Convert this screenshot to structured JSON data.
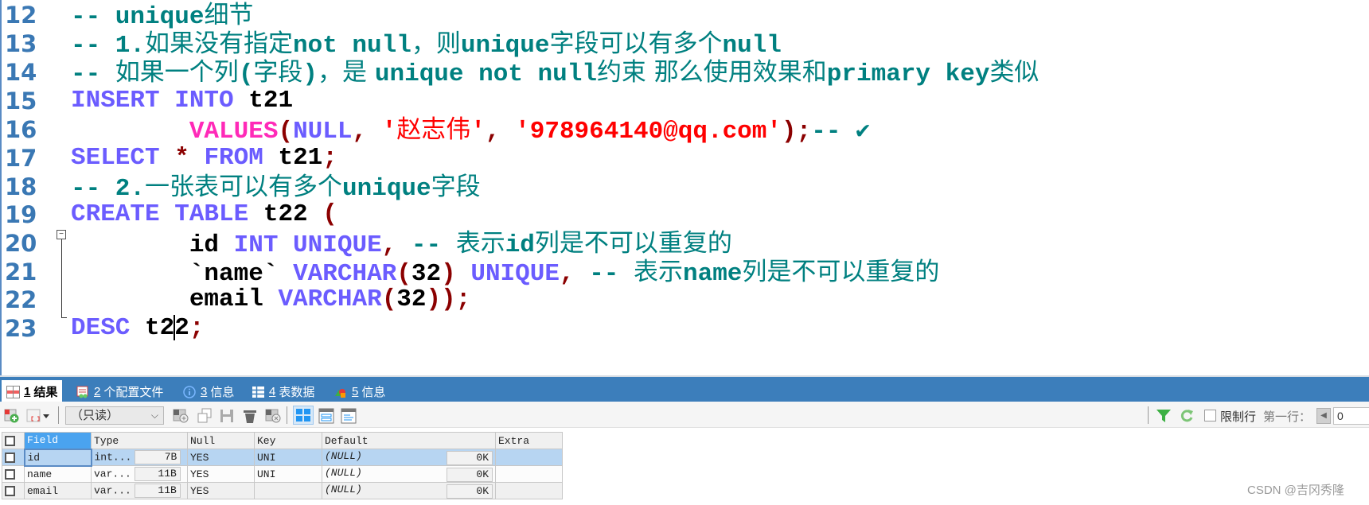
{
  "editor": {
    "lines": [
      {
        "no": "12",
        "segments": [
          {
            "t": "-- unique",
            "c": "cmt"
          },
          {
            "t": "细节",
            "c": "cmt cjk"
          }
        ]
      },
      {
        "no": "13",
        "segments": [
          {
            "t": "-- 1.",
            "c": "cmt"
          },
          {
            "t": "如果没有指定",
            "c": "cmt cjk"
          },
          {
            "t": "not null",
            "c": "cmt"
          },
          {
            "t": "，则",
            "c": "cmt cjk"
          },
          {
            "t": "unique",
            "c": "cmt"
          },
          {
            "t": "字段可以有多个",
            "c": "cmt cjk"
          },
          {
            "t": "null",
            "c": "cmt"
          }
        ]
      },
      {
        "no": "14",
        "segments": [
          {
            "t": "-- ",
            "c": "cmt"
          },
          {
            "t": "如果一个列",
            "c": "cmt cjk"
          },
          {
            "t": "(",
            "c": "cmt"
          },
          {
            "t": "字段",
            "c": "cmt cjk"
          },
          {
            "t": ")",
            "c": "cmt"
          },
          {
            "t": "，是 ",
            "c": "cmt cjk"
          },
          {
            "t": "unique not null",
            "c": "cmt"
          },
          {
            "t": "约束 那么使用效果和",
            "c": "cmt cjk"
          },
          {
            "t": "primary key",
            "c": "cmt"
          },
          {
            "t": "类似",
            "c": "cmt cjk"
          }
        ]
      },
      {
        "no": "15",
        "segments": [
          {
            "t": "INSERT INTO ",
            "c": "kw"
          },
          {
            "t": "t21",
            "c": "id"
          }
        ]
      },
      {
        "no": "16",
        "segments": [
          {
            "t": "        ",
            "c": "id"
          },
          {
            "t": "VALUES",
            "c": "fn"
          },
          {
            "t": "(",
            "c": "punc"
          },
          {
            "t": "NULL",
            "c": "kw"
          },
          {
            "t": ", ",
            "c": "punc"
          },
          {
            "t": "'",
            "c": "str"
          },
          {
            "t": "赵志伟",
            "c": "str cjk"
          },
          {
            "t": "'",
            "c": "str"
          },
          {
            "t": ", ",
            "c": "punc"
          },
          {
            "t": "'978964140@qq.com'",
            "c": "str"
          },
          {
            "t": ");",
            "c": "punc"
          },
          {
            "t": "-- ",
            "c": "cmt"
          },
          {
            "t": "✔",
            "c": "check"
          }
        ]
      },
      {
        "no": "17",
        "segments": [
          {
            "t": "SELECT ",
            "c": "kw"
          },
          {
            "t": "* ",
            "c": "punc"
          },
          {
            "t": "FROM ",
            "c": "kw"
          },
          {
            "t": "t21",
            "c": "id"
          },
          {
            "t": ";",
            "c": "punc"
          }
        ]
      },
      {
        "no": "18",
        "segments": [
          {
            "t": "-- 2.",
            "c": "cmt"
          },
          {
            "t": "一张表可以有多个",
            "c": "cmt cjk"
          },
          {
            "t": "unique",
            "c": "cmt"
          },
          {
            "t": "字段",
            "c": "cmt cjk"
          }
        ]
      },
      {
        "no": "19",
        "segments": [
          {
            "t": "CREATE TABLE ",
            "c": "kw"
          },
          {
            "t": "t22 ",
            "c": "id"
          },
          {
            "t": "(",
            "c": "punc"
          }
        ]
      },
      {
        "no": "20",
        "segments": [
          {
            "t": "        ",
            "c": "id"
          },
          {
            "t": "id ",
            "c": "id"
          },
          {
            "t": "INT UNIQUE",
            "c": "kw"
          },
          {
            "t": ", ",
            "c": "punc"
          },
          {
            "t": "-- ",
            "c": "cmt"
          },
          {
            "t": "表示",
            "c": "cmt cjk"
          },
          {
            "t": "id",
            "c": "cmt"
          },
          {
            "t": "列是不可以重复的",
            "c": "cmt cjk"
          }
        ]
      },
      {
        "no": "21",
        "segments": [
          {
            "t": "        ",
            "c": "id"
          },
          {
            "t": "`name` ",
            "c": "id"
          },
          {
            "t": "VARCHAR",
            "c": "kw"
          },
          {
            "t": "(",
            "c": "punc"
          },
          {
            "t": "32",
            "c": "id"
          },
          {
            "t": ") ",
            "c": "punc"
          },
          {
            "t": "UNIQUE",
            "c": "kw"
          },
          {
            "t": ", ",
            "c": "punc"
          },
          {
            "t": "-- ",
            "c": "cmt"
          },
          {
            "t": "表示",
            "c": "cmt cjk"
          },
          {
            "t": "name",
            "c": "cmt"
          },
          {
            "t": "列是不可以重复的",
            "c": "cmt cjk"
          }
        ]
      },
      {
        "no": "22",
        "segments": [
          {
            "t": "        ",
            "c": "id"
          },
          {
            "t": "email ",
            "c": "id"
          },
          {
            "t": "VARCHAR",
            "c": "kw"
          },
          {
            "t": "(",
            "c": "punc"
          },
          {
            "t": "32",
            "c": "id"
          },
          {
            "t": "));",
            "c": "punc"
          }
        ]
      },
      {
        "no": "23",
        "segments": [
          {
            "t": "DESC ",
            "c": "kw"
          },
          {
            "t": "t2",
            "c": "id"
          },
          {
            "t": "|caret|",
            "c": "caret"
          },
          {
            "t": "2",
            "c": "id"
          },
          {
            "t": ";",
            "c": "punc"
          }
        ]
      }
    ]
  },
  "tabs": [
    {
      "num": "1",
      "label": "结果",
      "icon": "result-grid-icon",
      "active": true
    },
    {
      "num": "2",
      "label": "个配置文件",
      "icon": "profile-icon",
      "active": false
    },
    {
      "num": "3",
      "label": "信息",
      "icon": "info-icon",
      "active": false
    },
    {
      "num": "4",
      "label": "表数据",
      "icon": "table-data-icon",
      "active": false
    },
    {
      "num": "5",
      "label": "信息",
      "icon": "shapes-info-icon",
      "active": false
    }
  ],
  "toolbar": {
    "mode_select": "（只读）",
    "limit_rows_label": "限制行",
    "first_row_label": "第一行：",
    "first_row_value": "0",
    "limit_rows_checked": false
  },
  "result": {
    "columns": [
      "Field",
      "Type",
      "Null",
      "Key",
      "Default",
      "Extra"
    ],
    "rows": [
      {
        "field": "id",
        "type": "int...",
        "type_size": "7B",
        "null": "YES",
        "key": "UNI",
        "default": "(NULL)",
        "default_size": "0K",
        "extra": ""
      },
      {
        "field": "name",
        "type": "var...",
        "type_size": "11B",
        "null": "YES",
        "key": "UNI",
        "default": "(NULL)",
        "default_size": "0K",
        "extra": ""
      },
      {
        "field": "email",
        "type": "var...",
        "type_size": "11B",
        "null": "YES",
        "key": "",
        "default": "(NULL)",
        "default_size": "0K",
        "extra": ""
      }
    ]
  },
  "watermark": "CSDN @吉冈秀隆"
}
